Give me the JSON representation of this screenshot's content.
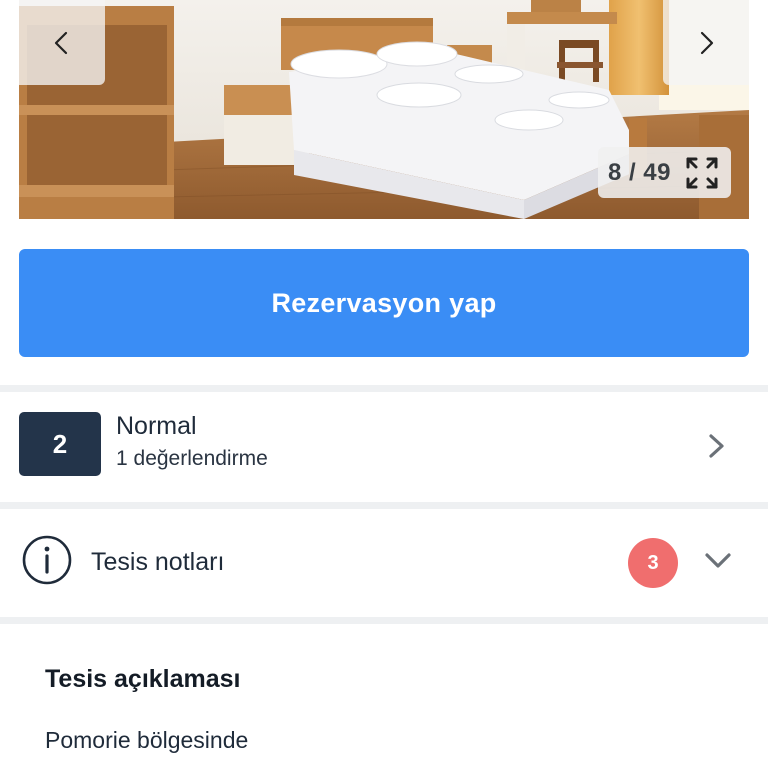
{
  "gallery": {
    "current": "8 / 49",
    "icons": {
      "prev": "chevron-left-icon",
      "next": "chevron-right-icon",
      "fullscreen": "expand-icon"
    }
  },
  "reserve_button": {
    "label": "Rezervasyon yap",
    "color": "#3a8df5"
  },
  "rating": {
    "score": "2",
    "title": "Normal",
    "subtitle": "1 değerlendirme",
    "score_bg": "#23344a"
  },
  "notes": {
    "label": "Tesis notları",
    "badge": "3",
    "badge_color": "#f06e6e",
    "icons": {
      "info": "info-icon",
      "toggle": "chevron-down-icon"
    }
  },
  "description": {
    "title": "Tesis açıklaması",
    "text": "Pomorie bölgesinde"
  }
}
